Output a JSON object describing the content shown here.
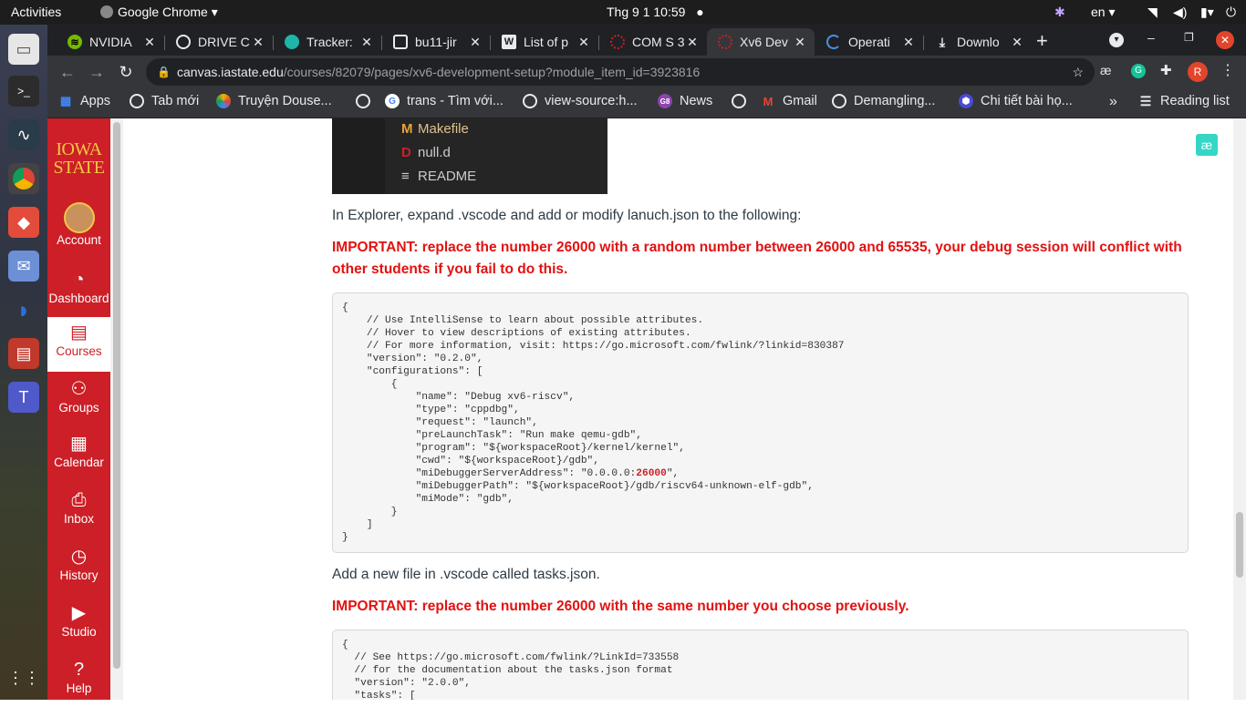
{
  "system_bar": {
    "activities": "Activities",
    "app_name": "Google Chrome",
    "datetime": "Thg 9 1  10:59",
    "language": "en"
  },
  "tabs": [
    {
      "label": "NVIDIA",
      "icon_color": "#76b900"
    },
    {
      "label": "DRIVE C",
      "icon_color": "#e8eaed"
    },
    {
      "label": "Tracker:",
      "icon_color": "#1fb5a8"
    },
    {
      "label": "bu11-jir",
      "icon_color": "#e8eaed"
    },
    {
      "label": "List of p",
      "icon_color": "#e8eaed"
    },
    {
      "label": "COM S 3",
      "icon_color": "#cc1f27"
    },
    {
      "label": "Xv6 Dev",
      "icon_color": "#cc1f27",
      "active": true
    },
    {
      "label": "Operati",
      "icon_color": "#4a90e2"
    },
    {
      "label": "Downlo",
      "icon_color": "#e8eaed"
    }
  ],
  "url": {
    "host": "canvas.iastate.edu",
    "path": "/courses/82079/pages/xv6-development-setup?module_item_id=3923816"
  },
  "bookmarks": [
    {
      "label": "Apps"
    },
    {
      "label": "Tab mới"
    },
    {
      "label": "Truyện Douse..."
    },
    {
      "label": ""
    },
    {
      "label": "trans - Tìm với..."
    },
    {
      "label": "view-source:h..."
    },
    {
      "label": "News"
    },
    {
      "label": ""
    },
    {
      "label": "Gmail"
    },
    {
      "label": "Demangling..."
    },
    {
      "label": "Chi tiết bài họ..."
    }
  ],
  "reading_list": "Reading list",
  "profile_initial": "R",
  "canvas_nav": {
    "logo_line1": "IOWA",
    "logo_line2": "STATE",
    "items": [
      {
        "label": "Account"
      },
      {
        "label": "Dashboard"
      },
      {
        "label": "Courses"
      },
      {
        "label": "Groups"
      },
      {
        "label": "Calendar"
      },
      {
        "label": "Inbox"
      },
      {
        "label": "History"
      },
      {
        "label": "Studio"
      },
      {
        "label": "Help"
      }
    ]
  },
  "explorer_files": [
    {
      "icon": "M",
      "name": "Makefile",
      "icon_color": "#e8a33d",
      "name_color": "#e2c08d"
    },
    {
      "icon": "D",
      "name": "null.d",
      "icon_color": "#cc1f27",
      "name_color": "#cccccc"
    },
    {
      "icon": "≡",
      "name": "README",
      "icon_color": "#cccccc",
      "name_color": "#cccccc"
    }
  ],
  "content": {
    "para1": "In Explorer, expand .vscode and add or modify lanuch.json to the following:",
    "warn1": "IMPORTANT: replace the number 26000 with a random number between 26000 and 65535, your debug session will conflict with other students if you fail to do this.",
    "code1_before": "{\n    // Use IntelliSense to learn about possible attributes.\n    // Hover to view descriptions of existing attributes.\n    // For more information, visit: https://go.microsoft.com/fwlink/?linkid=830387\n    \"version\": \"0.2.0\",\n    \"configurations\": [\n        {\n            \"name\": \"Debug xv6-riscv\",\n            \"type\": \"cppdbg\",\n            \"request\": \"launch\",\n            \"preLaunchTask\": \"Run make qemu-gdb\",\n            \"program\": \"${workspaceRoot}/kernel/kernel\",\n            \"cwd\": \"${workspaceRoot}/gdb\",\n            \"miDebuggerServerAddress\": \"0.0.0.0:",
    "code1_highlight": "26000",
    "code1_after": "\",\n            \"miDebuggerPath\": \"${workspaceRoot}/gdb/riscv64-unknown-elf-gdb\",\n            \"miMode\": \"gdb\",\n        }\n    ]\n}",
    "para2": "Add a new file in .vscode called tasks.json.",
    "warn2": "IMPORTANT: replace the number 26000 with the same number you choose previously.",
    "code2": "{\n  // See https://go.microsoft.com/fwlink/?LinkId=733558\n  // for the documentation about the tasks.json format\n  \"version\": \"2.0.0\",\n  \"tasks\": ["
  },
  "colors": {
    "canvas_red": "#cc1f27",
    "warning_red": "#e21111",
    "iowa_gold": "#f4c645"
  }
}
